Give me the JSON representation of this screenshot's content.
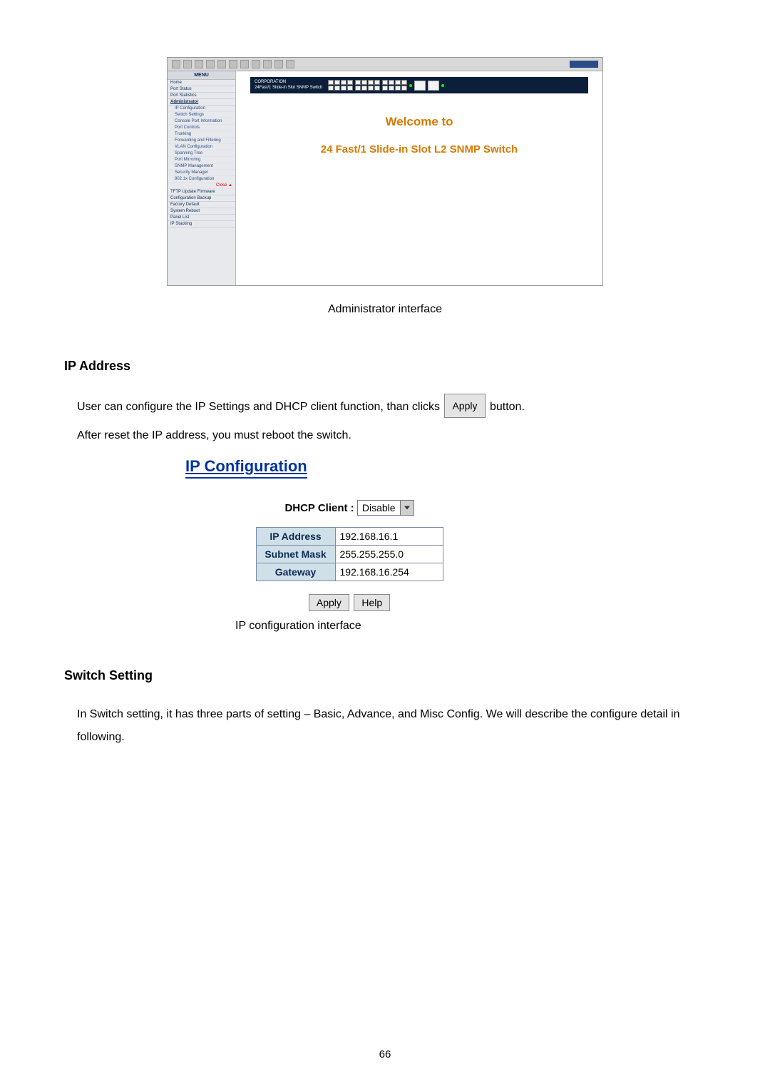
{
  "admin_shot": {
    "menu_title": "MENU",
    "menu": {
      "top": [
        "Home",
        "Port Status",
        "Port Statistics",
        "Administrator"
      ],
      "subs": [
        "IP Configuration",
        "Switch Settings",
        "Console Port Information",
        "Port Controls",
        "Trunking",
        "Forwarding and Filtering",
        "VLAN Configuration",
        "Spanning Tree",
        "Port Mirroring",
        "SNMP Management",
        "Security Manager",
        "802.1x Configuration"
      ],
      "close": "Close ▲",
      "bottom": [
        "TFTP Update Firmware",
        "Configuration Backup",
        "Factory Default",
        "System Reboot",
        "Panel List",
        "IP Stacking"
      ]
    },
    "banner_line1": "CORPORATION",
    "banner_line2": "24Fast/1 Slide-in Slot SNMP Switch",
    "welcome": "Welcome to",
    "product": "24 Fast/1 Slide-in Slot L2 SNMP Switch"
  },
  "captions": {
    "admin": "Administrator interface",
    "ipconf": "IP configuration interface"
  },
  "sections": {
    "ip_address": "IP Address",
    "switch_setting": "Switch Setting"
  },
  "text": {
    "ip_para_before_btn": "User can configure the IP Settings and DHCP client function, than clicks",
    "ip_para_after_btn": "button.",
    "ip_para_2": "After reset the IP address, you must reboot the switch.",
    "switch_para": "In Switch setting, it has three parts of setting – Basic, Advance, and Misc Config. We will describe the configure detail in following."
  },
  "buttons": {
    "apply": "Apply",
    "help": "Help"
  },
  "ipconf": {
    "title": "IP Configuration",
    "dhcp_label": "DHCP Client :",
    "dhcp_value": "Disable",
    "rows": {
      "ip_label": "IP Address",
      "ip_value": "192.168.16.1",
      "mask_label": "Subnet Mask",
      "mask_value": "255.255.255.0",
      "gw_label": "Gateway",
      "gw_value": "192.168.16.254"
    }
  },
  "page_number": "66"
}
